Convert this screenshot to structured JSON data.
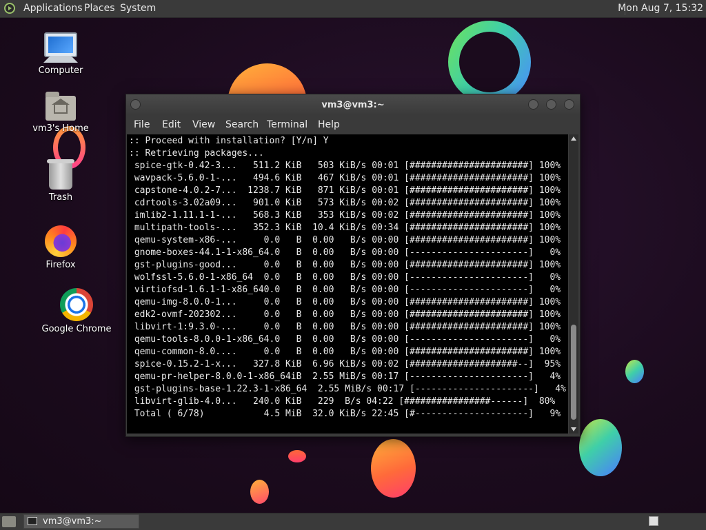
{
  "top_panel": {
    "menus": [
      "Applications",
      "Places",
      "System"
    ],
    "clock": "Mon Aug  7, 15:32"
  },
  "desktop_icons": [
    {
      "label": "Computer",
      "icon": "computer-icon"
    },
    {
      "label": "vm3's Home",
      "icon": "home-folder-icon"
    },
    {
      "label": "Trash",
      "icon": "trash-icon"
    },
    {
      "label": "Firefox",
      "icon": "firefox-icon"
    },
    {
      "label": "Google Chrome",
      "icon": "chrome-icon"
    }
  ],
  "terminal": {
    "title": "vm3@vm3:~",
    "menu": [
      "File",
      "Edit",
      "View",
      "Search",
      "Terminal",
      "Help"
    ],
    "lines": [
      ":: Proceed with installation? [Y/n] Y",
      ":: Retrieving packages...",
      " spice-gtk-0.42-3...   511.2 KiB   503 KiB/s 00:01 [######################] 100%",
      " wavpack-5.6.0-1-...   494.6 KiB   467 KiB/s 00:01 [######################] 100%",
      " capstone-4.0.2-7...  1238.7 KiB   871 KiB/s 00:01 [######################] 100%",
      " cdrtools-3.02a09...   901.0 KiB   573 KiB/s 00:02 [######################] 100%",
      " imlib2-1.11.1-1-...   568.3 KiB   353 KiB/s 00:02 [######################] 100%",
      " multipath-tools-...   352.3 KiB  10.4 KiB/s 00:34 [######################] 100%",
      " qemu-system-x86-...     0.0   B  0.00   B/s 00:00 [######################] 100%",
      " gnome-boxes-44.1-1-x86_64.0   B  0.00   B/s 00:00 [----------------------]   0%",
      " gst-plugins-good...     0.0   B  0.00   B/s 00:00 [######################] 100%",
      " wolfssl-5.6.0-1-x86_64  0.0   B  0.00   B/s 00:00 [----------------------]   0%",
      " virtiofsd-1.6.1-1-x86_640.0   B  0.00   B/s 00:00 [----------------------]   0%",
      " qemu-img-8.0.0-1...     0.0   B  0.00   B/s 00:00 [######################] 100%",
      " edk2-ovmf-202302...     0.0   B  0.00   B/s 00:00 [######################] 100%",
      " libvirt-1:9.3.0-...     0.0   B  0.00   B/s 00:00 [######################] 100%",
      " qemu-tools-8.0.0-1-x86_64.0   B  0.00   B/s 00:00 [----------------------]   0%",
      " qemu-common-8.0....     0.0   B  0.00   B/s 00:00 [######################] 100%",
      " spice-0.15.2-1-x...   327.8 KiB  6.96 KiB/s 00:02 [####################--]  95%",
      " qemu-pr-helper-8.0.0-1-x86_64iB  2.55 MiB/s 00:17 [----------------------]   4%",
      " gst-plugins-base-1.22.3-1-x86_64  2.55 MiB/s 00:17 [----------------------]   4%",
      " libvirt-glib-4.0...   240.0 KiB   229  B/s 04:22 [################------]  80%",
      " Total ( 6/78)           4.5 MiB  32.0 KiB/s 22:45 [#---------------------]   9%"
    ]
  },
  "bottom_panel": {
    "task_label": "vm3@vm3:~"
  }
}
